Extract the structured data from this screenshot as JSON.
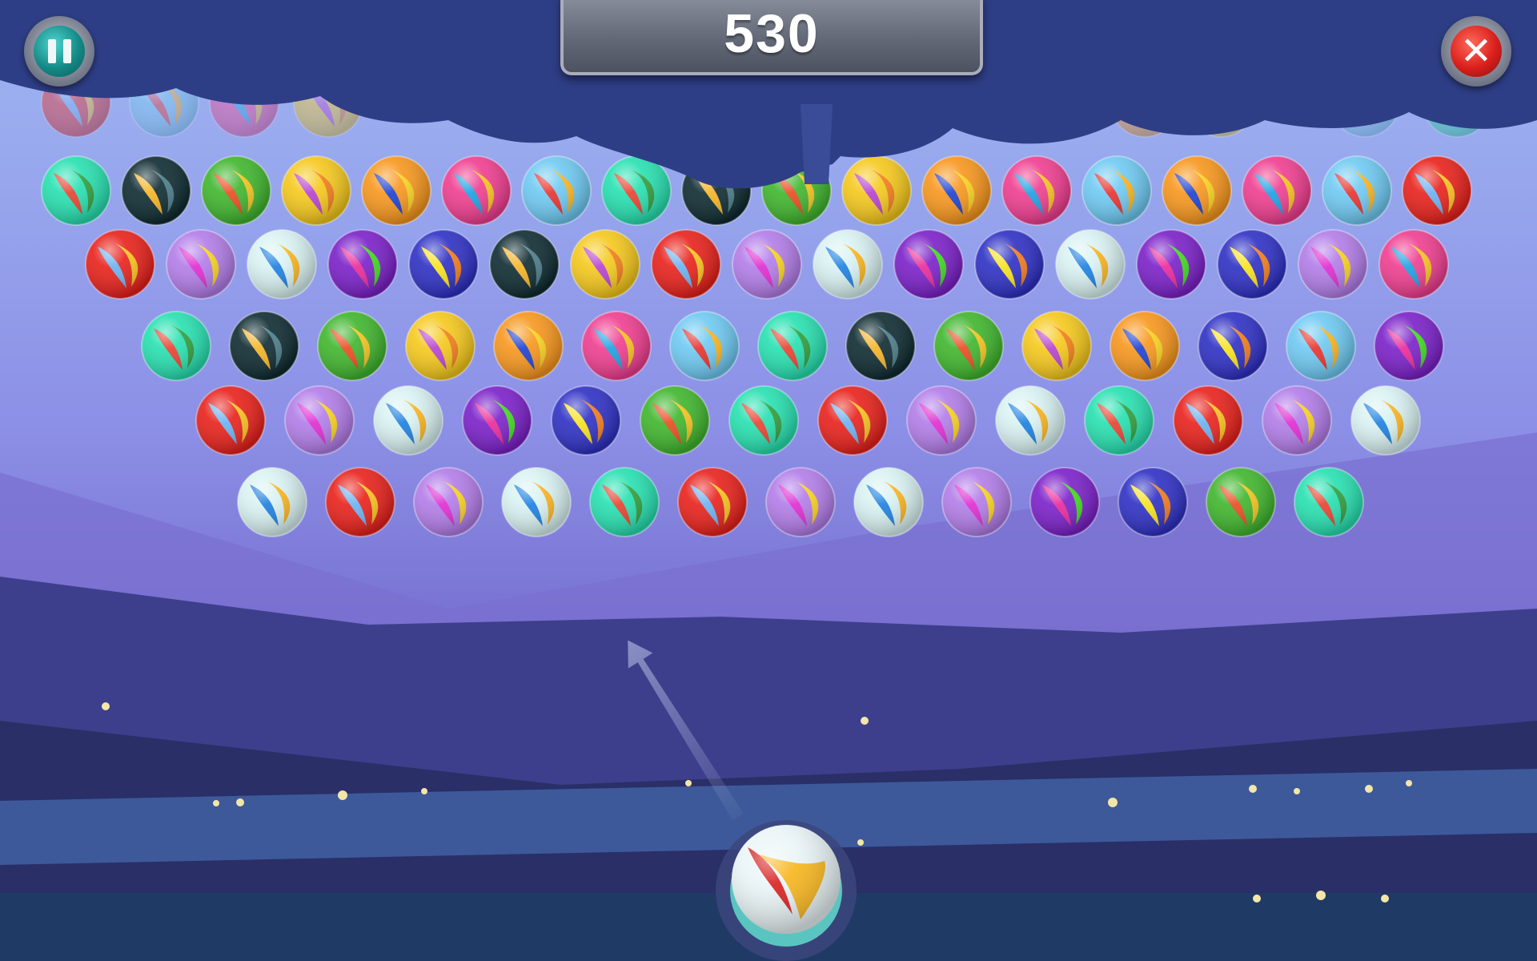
{
  "score": {
    "value": "530"
  },
  "hud": {
    "pause_icon": "pause-icon",
    "close_icon": "close-icon"
  },
  "colors": {
    "sky_top": "#8aa0e8",
    "sky_bottom": "#6a5fc9",
    "cloud": "#2f3f86",
    "ground": "#243c6e",
    "pause_button": "#148a86",
    "close_button": "#d91f1b",
    "score_plate": "#646a78"
  },
  "bubble_palette": {
    "teal": [
      "#26e0b0",
      "#e8402f",
      "#2f9b3a"
    ],
    "black": [
      "#0d2a30",
      "#f4b324",
      "#4a7a86"
    ],
    "green": [
      "#3fb52c",
      "#e84a1f",
      "#f4c21c"
    ],
    "yellow": [
      "#f5c81b",
      "#b640d0",
      "#f07b1a"
    ],
    "orange": [
      "#f7961c",
      "#1b3fd0",
      "#f7d21c"
    ],
    "pink": [
      "#ef3d8f",
      "#1b9fe0",
      "#f7c21c"
    ],
    "lightblue": [
      "#6ec9f2",
      "#e8302a",
      "#f7b21c"
    ],
    "red": [
      "#e8201a",
      "#6ab0f0",
      "#f7c21c"
    ],
    "lavender": [
      "#b27ce8",
      "#e02ad0",
      "#f7d21c"
    ],
    "white": [
      "#d9f2f2",
      "#1b7fe0",
      "#f7b21c"
    ],
    "purple": [
      "#7a1fc8",
      "#e8289a",
      "#3fd81c"
    ],
    "blue": [
      "#2d2fc4",
      "#f7e21c",
      "#f07b1a"
    ]
  },
  "grid": [
    [
      "teal",
      "black",
      "green",
      "yellow",
      "orange",
      "pink",
      "lightblue",
      "teal",
      "black",
      "green",
      "yellow",
      "orange",
      "pink",
      "lightblue",
      "orange",
      "pink",
      "lightblue",
      "red"
    ],
    [
      "red",
      "lavender",
      "white",
      "purple",
      "blue",
      "black",
      "yellow",
      "red",
      "lavender",
      "white",
      "purple",
      "blue",
      "white",
      "purple",
      "blue",
      "lavender",
      "pink"
    ],
    [
      "teal",
      "black",
      "green",
      "yellow",
      "orange",
      "pink",
      "lightblue",
      "teal",
      "black",
      "green",
      "yellow",
      "orange",
      "blue",
      "lightblue",
      "purple"
    ],
    [
      "red",
      "lavender",
      "white",
      "purple",
      "blue",
      "green",
      "teal",
      "red",
      "lavender",
      "white",
      "teal",
      "red",
      "lavender",
      "white"
    ],
    [
      "white",
      "red",
      "lavender",
      "white",
      "teal",
      "red",
      "lavender",
      "white",
      "lavender",
      "purple",
      "blue",
      "green",
      "teal"
    ]
  ],
  "hidden_row": [
    "red",
    "lightblue",
    "pink",
    "yellow",
    "pink",
    "orange",
    "yellow",
    "lightblue",
    "teal"
  ],
  "shooter": {
    "bubble_color": "white",
    "accent": [
      "#d81f1f",
      "#f7b51c"
    ]
  },
  "aim": {
    "angle_deg": -32
  }
}
